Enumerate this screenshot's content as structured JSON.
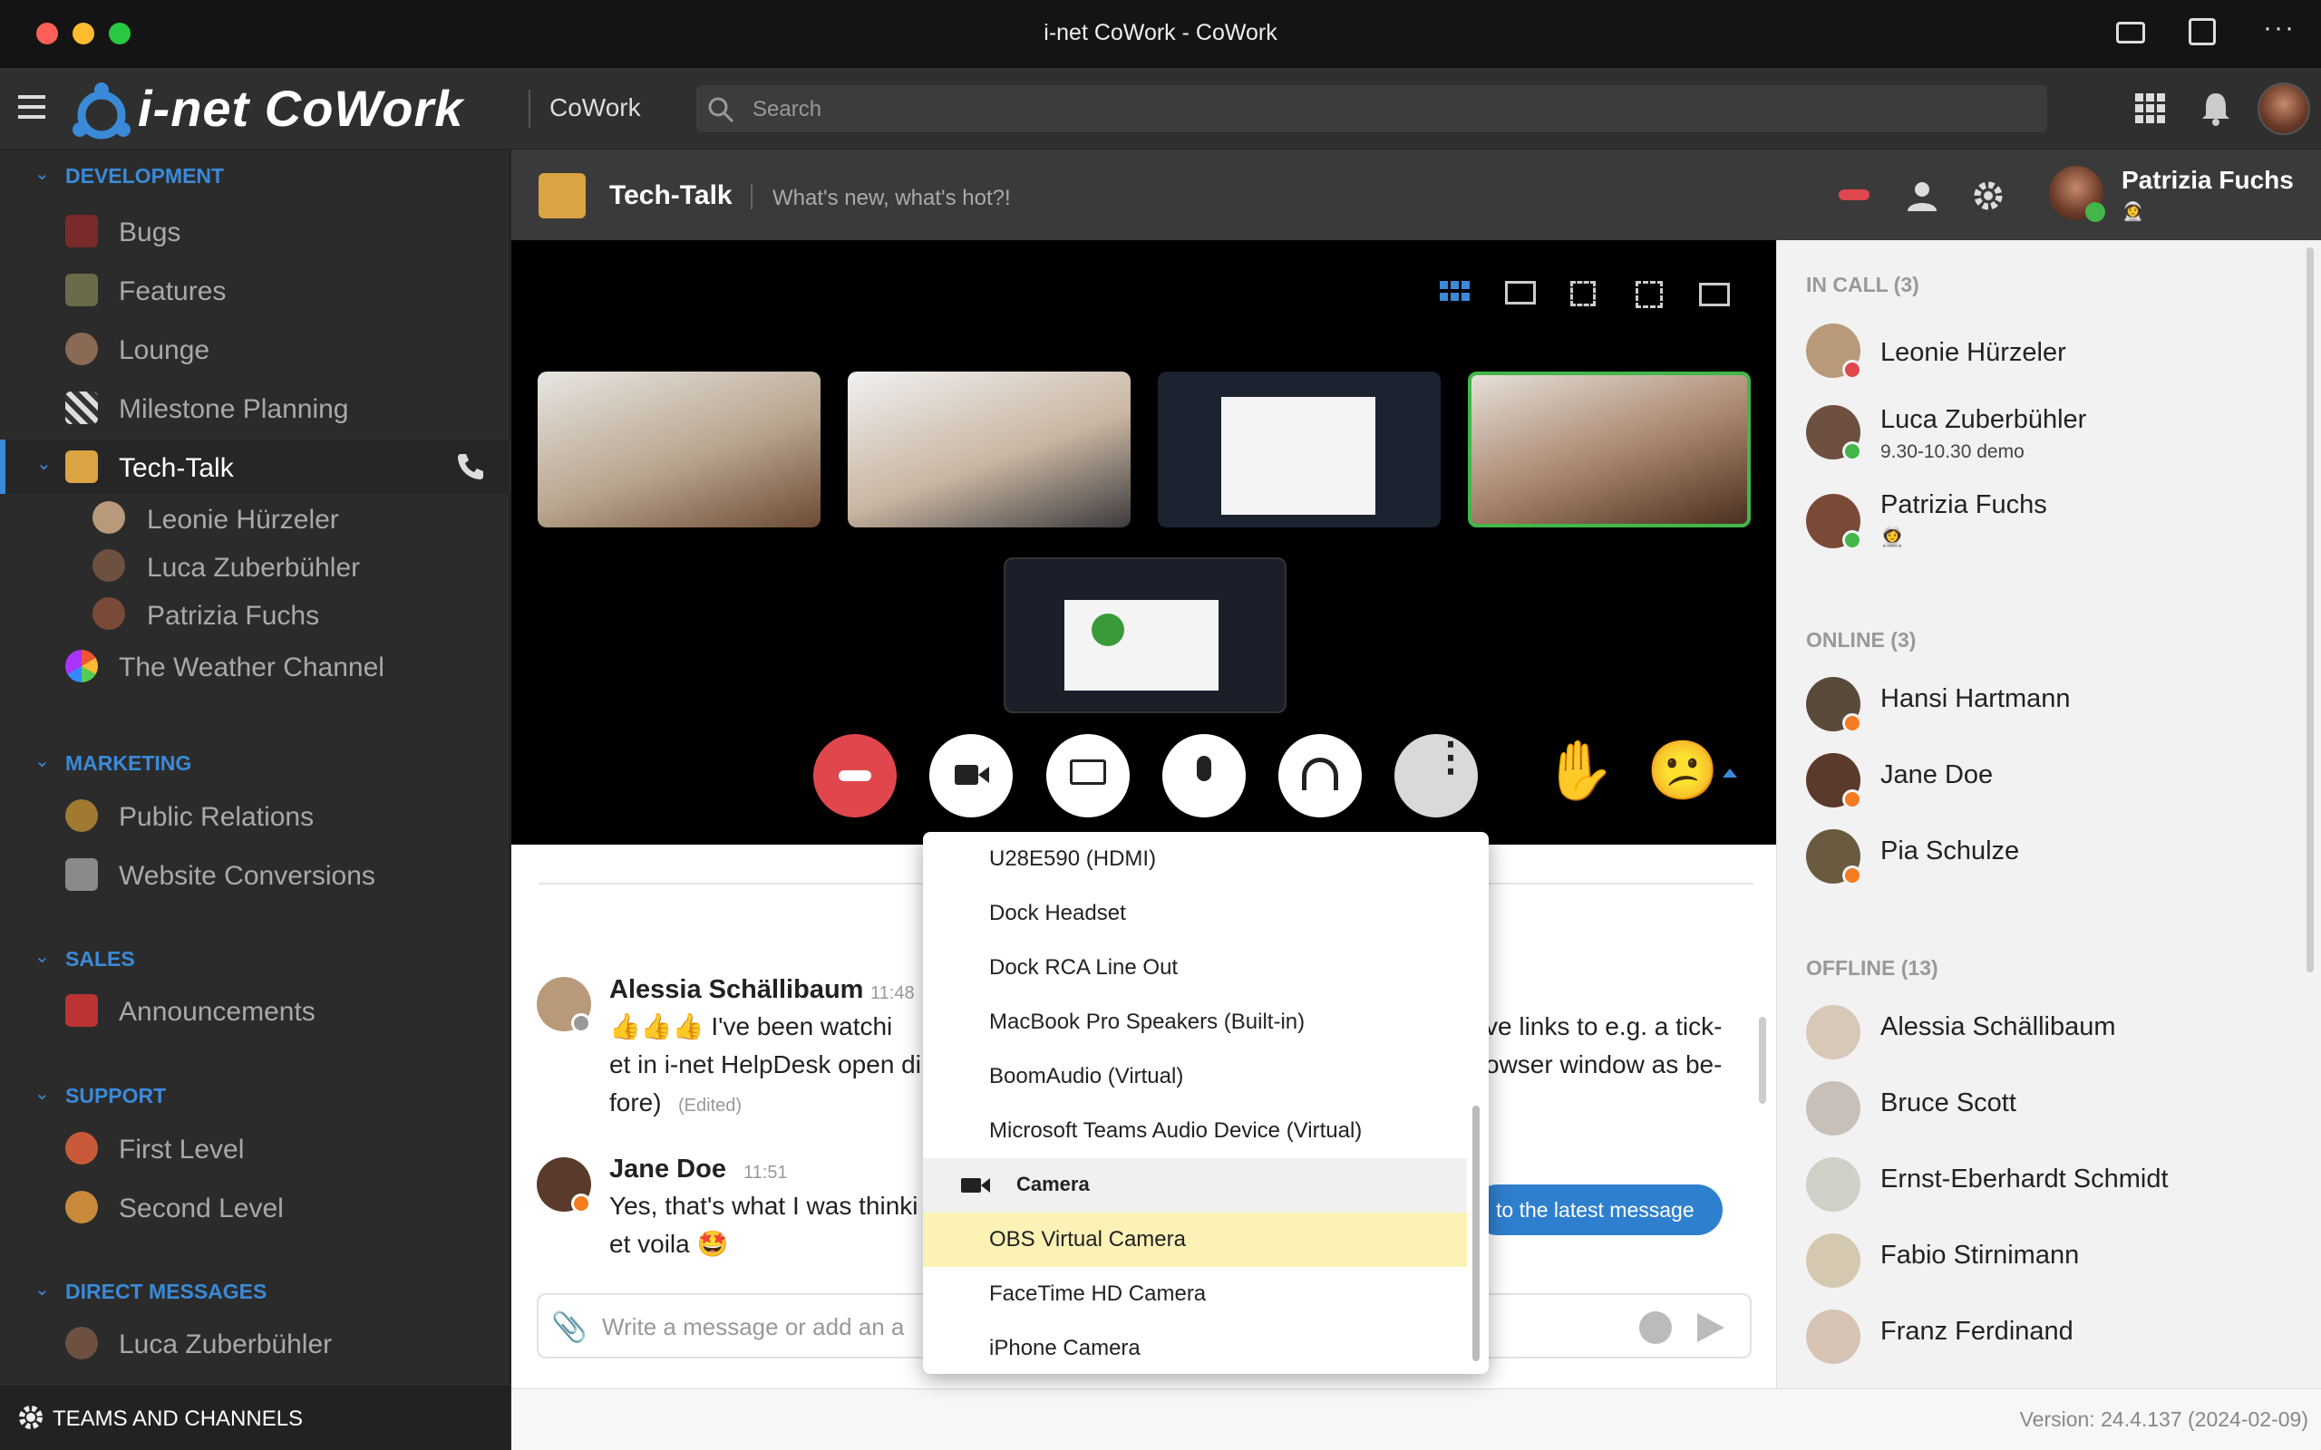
{
  "window": {
    "title": "i-net CoWork - CoWork"
  },
  "app": {
    "logo": "i-net CoWork",
    "name": "CoWork",
    "search_placeholder": "Search"
  },
  "sidebar": {
    "sections": [
      {
        "title": "DEVELOPMENT",
        "items": [
          "Bugs",
          "Features",
          "Lounge",
          "Milestone Planning",
          "Tech-Talk",
          "The Weather Channel"
        ]
      },
      {
        "title": "MARKETING",
        "items": [
          "Public Relations",
          "Website Conversions"
        ]
      },
      {
        "title": "SALES",
        "items": [
          "Announcements"
        ]
      },
      {
        "title": "SUPPORT",
        "items": [
          "First Level",
          "Second Level"
        ]
      },
      {
        "title": "DIRECT MESSAGES",
        "items": [
          "Luca Zuberbühler"
        ]
      }
    ],
    "techtalk_members": [
      "Leonie Hürzeler",
      "Luca Zuberbühler",
      "Patrizia Fuchs"
    ],
    "footer": "TEAMS AND CHANNELS"
  },
  "channel": {
    "title": "Tech-Talk",
    "subtitle": "What's new, what's hot?!",
    "user": "Patrizia Fuchs",
    "user_status": "👩‍🚀"
  },
  "messages": [
    {
      "name": "Alessia Schällibaum",
      "time": "11:48",
      "line1_start": "👍👍👍 I've been watchi",
      "line1_end": "ve links to e.g. a tick-",
      "line2_start": "et in i-net HelpDesk open di",
      "line2_end": "owser window as be-",
      "line3": "fore)",
      "edited": "(Edited)"
    },
    {
      "name": "Jane Doe",
      "time": "11:51",
      "line1": "Yes, that's what I was thinki",
      "line2": "et voila 🤩"
    }
  ],
  "jump_button": "to the latest message",
  "composer_placeholder": "Write a message or add an a",
  "right_panel": {
    "in_call_title": "IN CALL (3)",
    "in_call": [
      {
        "name": "Leonie Hürzeler",
        "status": ""
      },
      {
        "name": "Luca Zuberbühler",
        "status": "9.30-10.30 demo"
      },
      {
        "name": "Patrizia Fuchs",
        "status": "👩‍🚀"
      }
    ],
    "online_title": "ONLINE (3)",
    "online": [
      "Hansi Hartmann",
      "Jane Doe",
      "Pia Schulze"
    ],
    "offline_title": "OFFLINE (13)",
    "offline": [
      "Alessia Schällibaum",
      "Bruce Scott",
      "Ernst-Eberhardt Schmidt",
      "Fabio Stirnimann",
      "Franz Ferdinand"
    ]
  },
  "version": "Version: 24.4.137 (2024-02-09)",
  "device_menu": {
    "audio_items": [
      "U28E590 (HDMI)",
      "Dock Headset",
      "Dock RCA Line Out",
      "MacBook Pro Speakers (Built-in)",
      "BoomAudio (Virtual)",
      "Microsoft Teams Audio Device (Virtual)"
    ],
    "camera_header": "Camera",
    "camera_items": [
      "OBS Virtual Camera",
      "FaceTime HD Camera",
      "iPhone Camera"
    ],
    "selected_camera": "OBS Virtual Camera"
  },
  "colors": {
    "accent": "#3a8ad8",
    "hangup": "#e0474c",
    "active_tile_border": "#43b649",
    "highlight": "#fdf2b6",
    "away_badge": "#f47b20"
  }
}
